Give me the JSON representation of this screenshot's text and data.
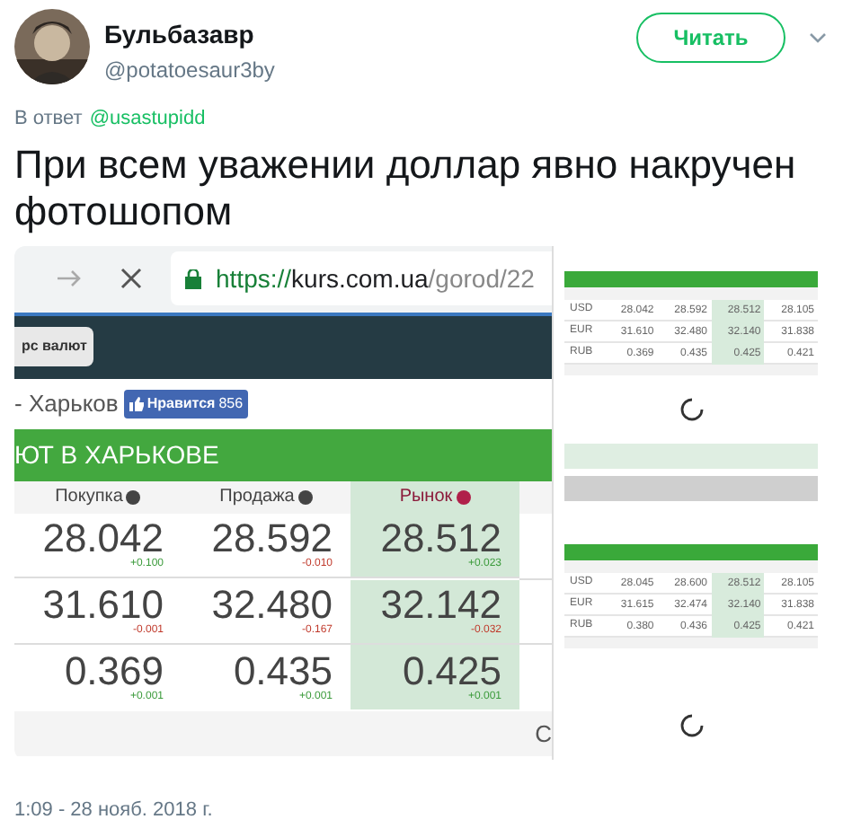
{
  "tweet": {
    "author": "Бульбазавр",
    "handle": "@potatoesaur3by",
    "follow_button": "Читать",
    "reply_prefix": "В ответ",
    "reply_to": "@usastupidd",
    "text": "При всем уважении доллар явно накручен фотошопом",
    "timestamp": "1:09 - 28 нояб. 2018 г."
  },
  "main_image": {
    "url_scheme": "https://",
    "url_host": "kurs.com.ua",
    "url_path": "/gorod/22",
    "nav_button": "рс валют",
    "city": "- Харьков",
    "like_button": {
      "label": "Нравится",
      "count": "856"
    },
    "banner": "ЮТ В ХАРЬКОВЕ",
    "columns": [
      {
        "label": "Покупка",
        "selected": false
      },
      {
        "label": "Продажа",
        "selected": false
      },
      {
        "label": "Рынок",
        "selected": true
      }
    ],
    "rows": [
      {
        "cells": [
          {
            "value": "28.042",
            "change": "+0.100",
            "color": "#3a9a3a"
          },
          {
            "value": "28.592",
            "change": "-0.010",
            "color": "#c0392b"
          },
          {
            "value": "28.512",
            "change": "+0.023",
            "color": "#3a9a3a"
          }
        ]
      },
      {
        "cells": [
          {
            "value": "31.610",
            "change": "-0.001",
            "color": "#c0392b"
          },
          {
            "value": "32.480",
            "change": "-0.167",
            "color": "#c0392b"
          },
          {
            "value": "32.142",
            "change": "-0.032",
            "color": "#c0392b"
          }
        ]
      },
      {
        "cells": [
          {
            "value": "0.369",
            "change": "+0.001",
            "color": "#3a9a3a"
          },
          {
            "value": "0.435",
            "change": "+0.001",
            "color": "#3a9a3a"
          },
          {
            "value": "0.425",
            "change": "+0.001",
            "color": "#3a9a3a"
          }
        ]
      }
    ],
    "footer_text": "С"
  },
  "side_image": {
    "tables": [
      {
        "rows": [
          {
            "currency": "USD",
            "values": [
              "28.042",
              "28.592",
              "28.512",
              "28.105"
            ]
          },
          {
            "currency": "EUR",
            "values": [
              "31.610",
              "32.480",
              "32.140",
              "31.838"
            ]
          },
          {
            "currency": "RUB",
            "values": [
              "0.369",
              "0.435",
              "0.425",
              "0.421"
            ]
          }
        ]
      },
      {
        "rows": [
          {
            "currency": "USD",
            "values": [
              "28.045",
              "28.600",
              "28.512",
              "28.105"
            ]
          },
          {
            "currency": "EUR",
            "values": [
              "31.615",
              "32.474",
              "32.140",
              "31.838"
            ]
          },
          {
            "currency": "RUB",
            "values": [
              "0.380",
              "0.436",
              "0.425",
              "0.421"
            ]
          }
        ]
      }
    ]
  }
}
